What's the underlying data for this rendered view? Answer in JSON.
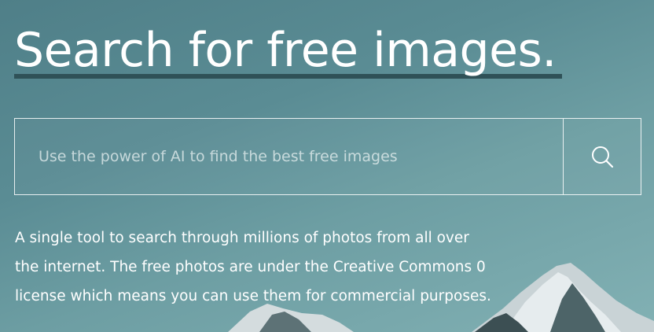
{
  "hero": {
    "title": "Search for free images.",
    "search": {
      "placeholder": "Use the power of AI to find the best free images",
      "value": "",
      "button_icon": "search-icon"
    },
    "description": "A single tool to search through millions of photos from all over the internet. The free photos are under the Creative Commons 0 license which means you can use them for commercial purposes."
  },
  "colors": {
    "sky_top": "#4f7f88",
    "sky_bottom": "#82b1b4",
    "underline": "#2f5157",
    "text": "#ffffff"
  }
}
